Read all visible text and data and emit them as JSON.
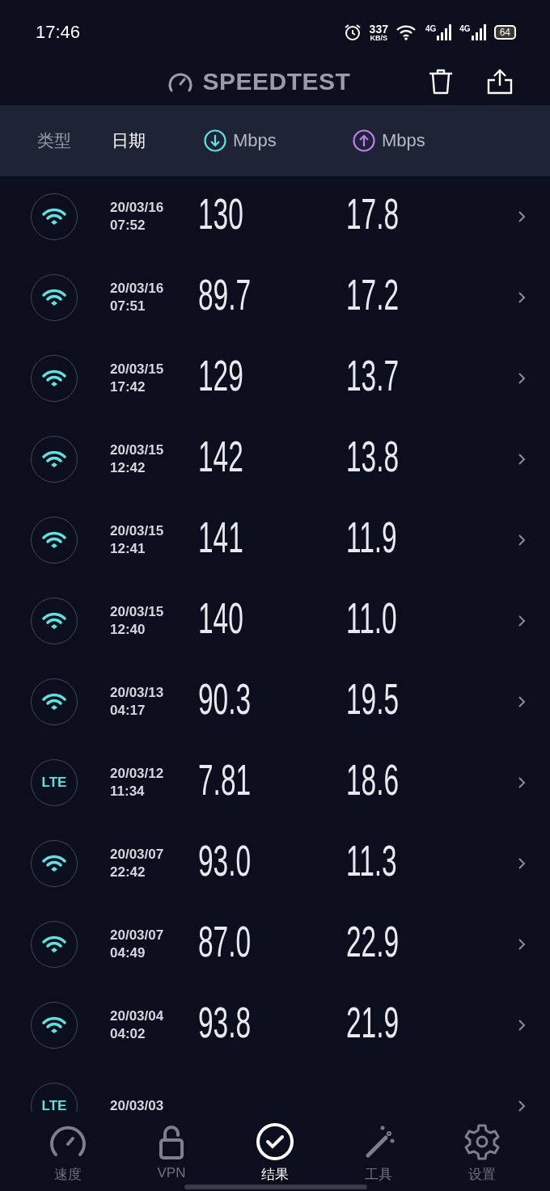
{
  "status_bar": {
    "time": "17:46",
    "net_speed": "337",
    "net_unit": "KB/S",
    "signals": [
      "4G",
      "4G"
    ],
    "battery": "64"
  },
  "header": {
    "title": "SPEEDTEST"
  },
  "columns": [
    {
      "label": "类型",
      "selected": false
    },
    {
      "label": "日期",
      "selected": true
    }
  ],
  "speed_columns": [
    {
      "kind": "download",
      "label": "Mbps"
    },
    {
      "kind": "upload",
      "label": "Mbps"
    }
  ],
  "results": [
    {
      "kind": "wifi",
      "date": "20/03/16",
      "time": "07:52",
      "download": "130",
      "upload": "17.8"
    },
    {
      "kind": "wifi",
      "date": "20/03/16",
      "time": "07:51",
      "download": "89.7",
      "upload": "17.2"
    },
    {
      "kind": "wifi",
      "date": "20/03/15",
      "time": "17:42",
      "download": "129",
      "upload": "13.7"
    },
    {
      "kind": "wifi",
      "date": "20/03/15",
      "time": "12:42",
      "download": "142",
      "upload": "13.8"
    },
    {
      "kind": "wifi",
      "date": "20/03/15",
      "time": "12:41",
      "download": "141",
      "upload": "11.9"
    },
    {
      "kind": "wifi",
      "date": "20/03/15",
      "time": "12:40",
      "download": "140",
      "upload": "11.0"
    },
    {
      "kind": "wifi",
      "date": "20/03/13",
      "time": "04:17",
      "download": "90.3",
      "upload": "19.5"
    },
    {
      "kind": "lte",
      "label": "LTE",
      "date": "20/03/12",
      "time": "11:34",
      "download": "7.81",
      "upload": "18.6"
    },
    {
      "kind": "wifi",
      "date": "20/03/07",
      "time": "22:42",
      "download": "93.0",
      "upload": "11.3"
    },
    {
      "kind": "wifi",
      "date": "20/03/07",
      "time": "04:49",
      "download": "87.0",
      "upload": "22.9"
    },
    {
      "kind": "wifi",
      "date": "20/03/04",
      "time": "04:02",
      "download": "93.8",
      "upload": "21.9"
    },
    {
      "kind": "lte",
      "label": "LTE",
      "date": "20/03/03"
    }
  ],
  "nav": [
    {
      "kind": "speed",
      "label": "速度",
      "selected": false
    },
    {
      "kind": "vpn",
      "label": "VPN",
      "selected": false
    },
    {
      "kind": "results",
      "label": "结果",
      "selected": true
    },
    {
      "kind": "tools",
      "label": "工具",
      "selected": false
    },
    {
      "kind": "settings",
      "label": "设置",
      "selected": false
    }
  ]
}
